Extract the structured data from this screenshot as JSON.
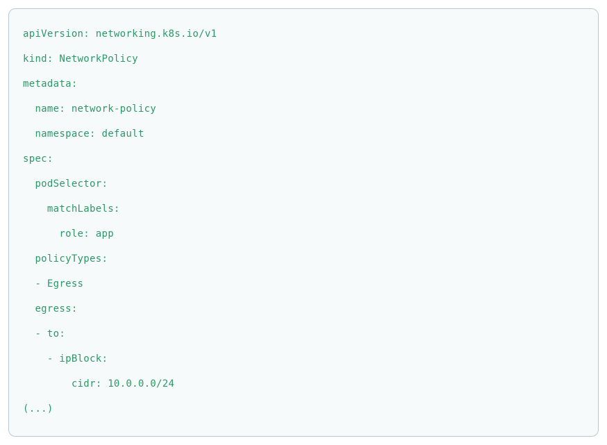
{
  "code": {
    "lines": [
      "apiVersion: networking.k8s.io/v1",
      "kind: NetworkPolicy",
      "metadata:",
      "  name: network-policy",
      "  namespace: default",
      "spec:",
      "  podSelector:",
      "    matchLabels:",
      "      role: app",
      "  policyTypes:",
      "  - Egress",
      "  egress:",
      "  - to:",
      "    - ipBlock:",
      "        cidr: 10.0.0.0/24",
      "(...)"
    ]
  }
}
